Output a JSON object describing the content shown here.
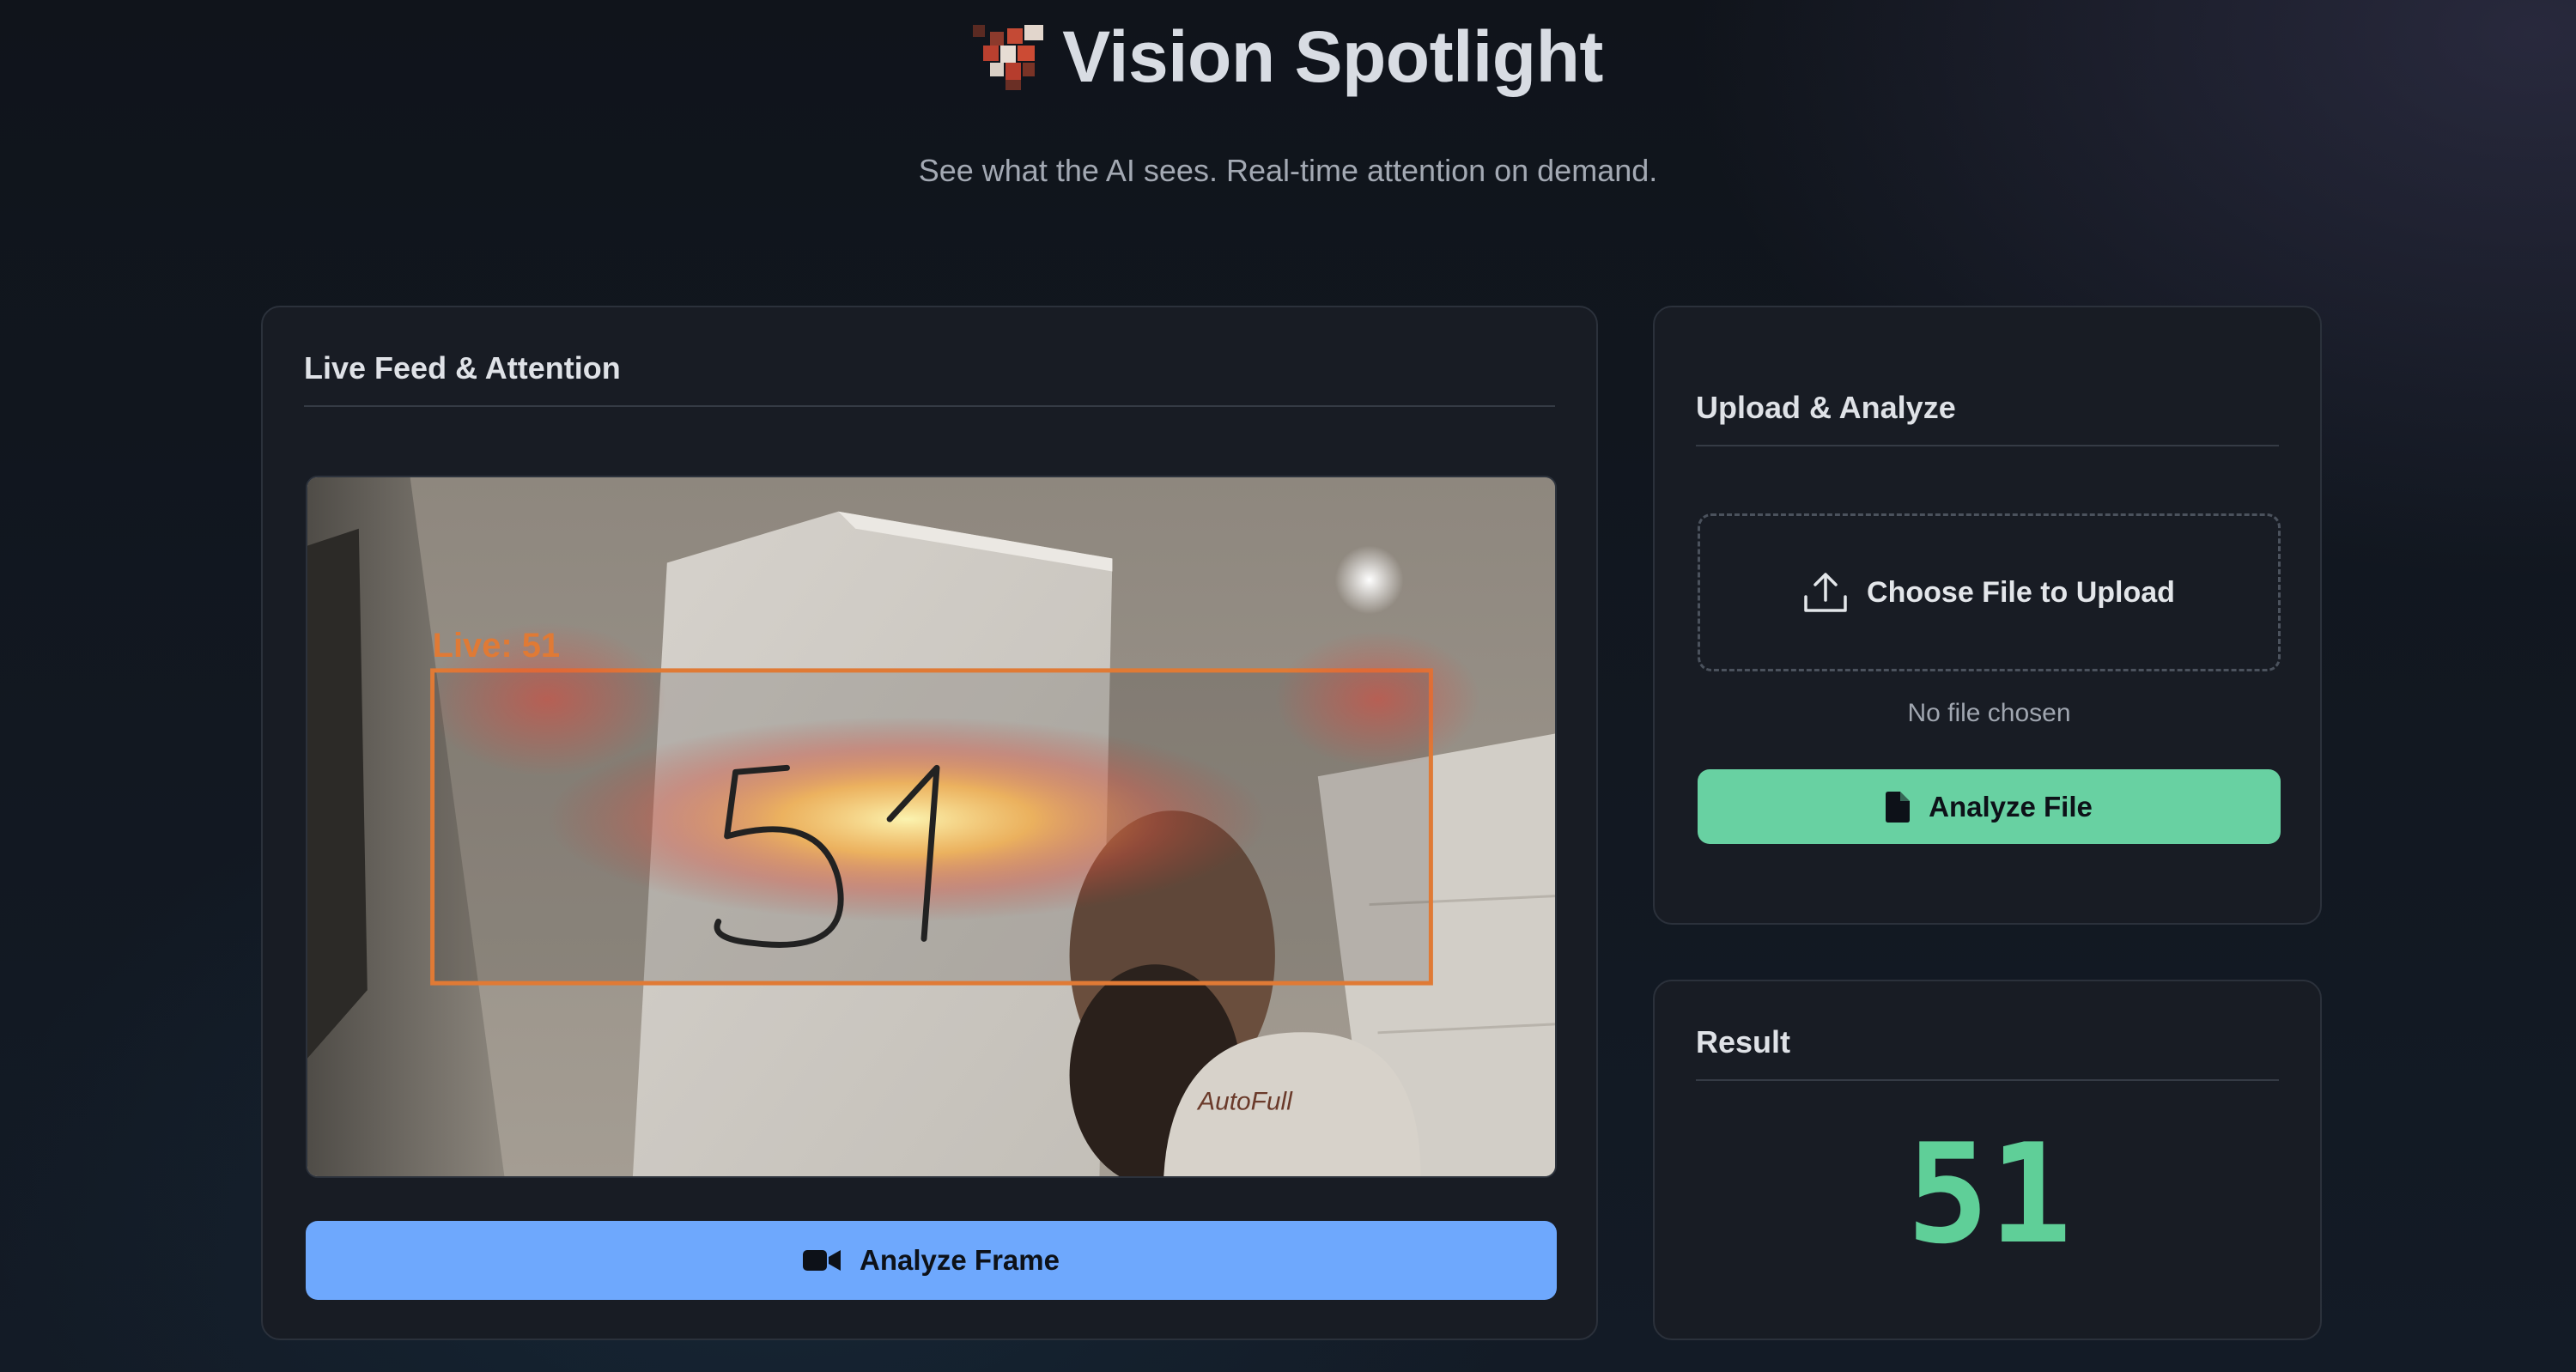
{
  "header": {
    "title": "Vision Spotlight",
    "subtitle": "See what the AI sees. Real-time attention on demand."
  },
  "live": {
    "title": "Live Feed & Attention",
    "overlay_label": "Live: 51",
    "analyze_button": "Analyze Frame",
    "button_icon": "video-camera-icon"
  },
  "upload": {
    "title": "Upload & Analyze",
    "choose_label": "Choose File to Upload",
    "choose_icon": "upload-icon",
    "file_status": "No file chosen",
    "analyze_button": "Analyze File",
    "button_icon": "file-icon"
  },
  "result": {
    "title": "Result",
    "value": "51"
  },
  "colors": {
    "primary_button": "#6ea8fd",
    "success_button": "#68d1a2",
    "result_text": "#5fcf98",
    "attention_box": "#e07a35"
  }
}
